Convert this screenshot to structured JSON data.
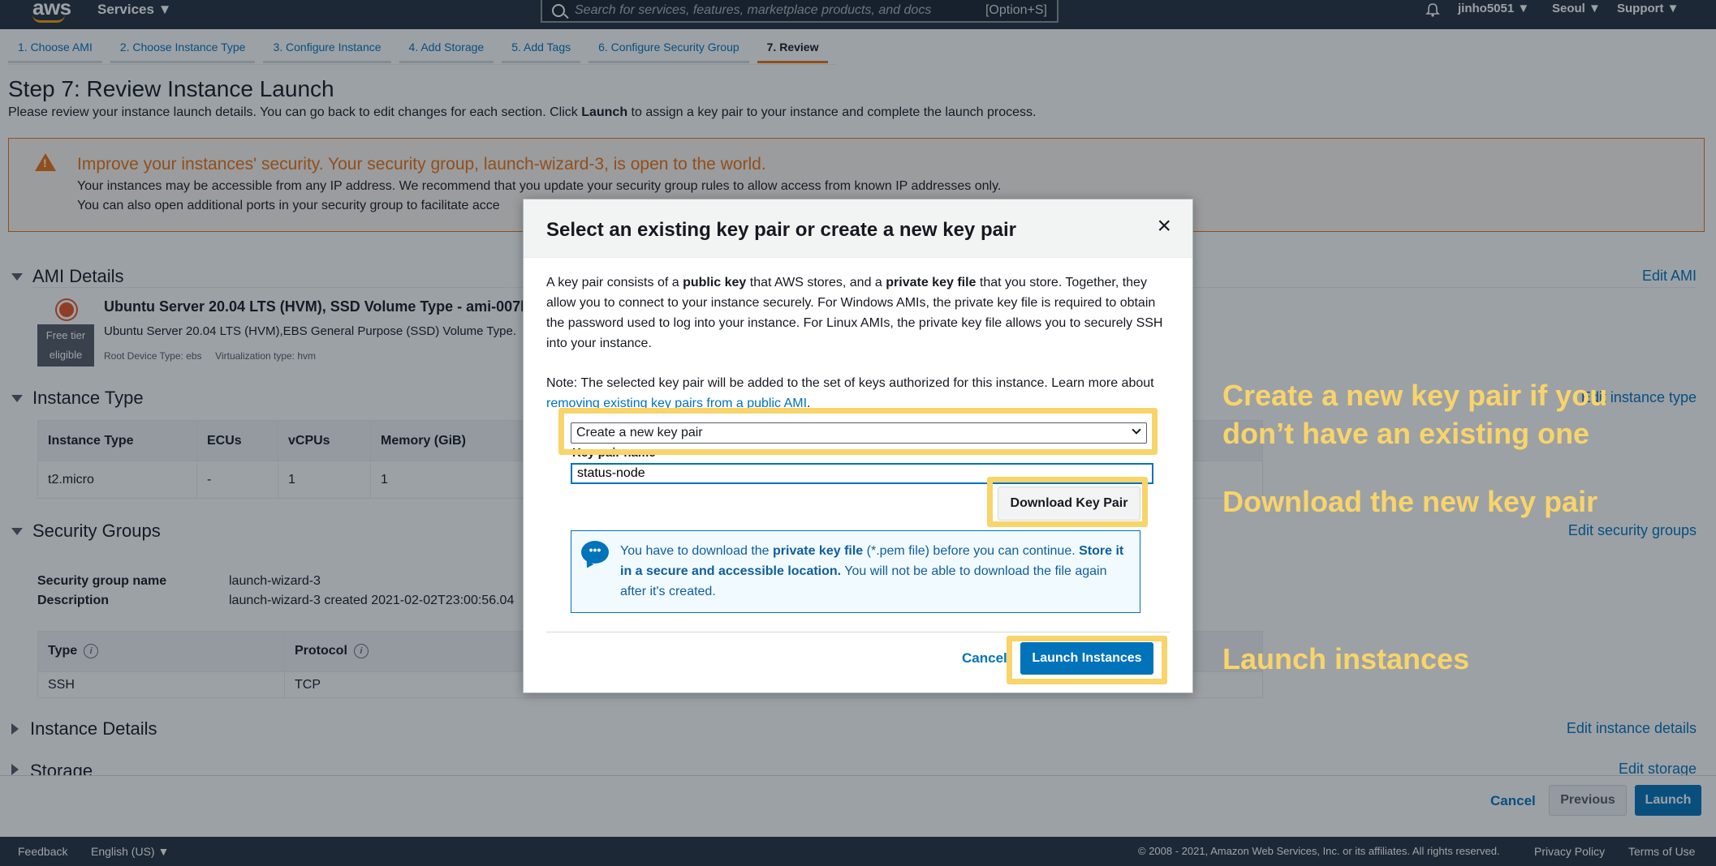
{
  "nav": {
    "logo": "aws",
    "services": "Services ▼",
    "search_placeholder": "Search for services, features, marketplace products, and docs",
    "search_shortcut": "[Option+S]",
    "user": "jinho5051 ▼",
    "region": "Seoul ▼",
    "support": "Support ▼"
  },
  "tabs": [
    "1. Choose AMI",
    "2. Choose Instance Type",
    "3. Configure Instance",
    "4. Add Storage",
    "5. Add Tags",
    "6. Configure Security Group",
    "7. Review"
  ],
  "page": {
    "title": "Step 7: Review Instance Launch",
    "desc_pre": "Please review your instance launch details. You can go back to edit changes for each section. Click ",
    "desc_bold": "Launch",
    "desc_post": " to assign a key pair to your instance and complete the launch process."
  },
  "warning": {
    "title": "Improve your instances' security. Your security group, launch-wizard-3, is open to the world.",
    "line1": "Your instances may be accessible from any IP address. We recommend that you update your security group rules to allow access from known IP addresses only.",
    "line2": "You can also open additional ports in your security group to facilitate acce"
  },
  "sections": {
    "ami": "AMI Details",
    "ami_edit": "Edit AMI",
    "instance_type": "Instance Type",
    "instance_type_edit": "Edit instance type",
    "security_groups": "Security Groups",
    "security_groups_edit": "Edit security groups",
    "instance_details": "Instance Details",
    "instance_details_edit": "Edit instance details",
    "storage": "Storage",
    "storage_edit": "Edit storage"
  },
  "ami": {
    "free_tier_1": "Free tier",
    "free_tier_2": "eligible",
    "name": "Ubuntu Server 20.04 LTS (HVM), SSD Volume Type - ami-007b",
    "sub": "Ubuntu Server 20.04 LTS (HVM),EBS General Purpose (SSD) Volume Type.",
    "meta": "Root Device Type: ebs     Virtualization type: hvm"
  },
  "instance_table": {
    "headers": [
      "Instance Type",
      "ECUs",
      "vCPUs",
      "Memory (GiB)"
    ],
    "row": [
      "t2.micro",
      "-",
      "1",
      "1"
    ]
  },
  "security": {
    "name_label": "Security group name",
    "name_value": "launch-wizard-3",
    "desc_label": "Description",
    "desc_value": "launch-wizard-3 created 2021-02-02T23:00:56.04",
    "headers": [
      "Type",
      "Protocol"
    ],
    "row": [
      "SSH",
      "TCP"
    ],
    "info": "i"
  },
  "bottom": {
    "cancel": "Cancel",
    "previous": "Previous",
    "launch": "Launch"
  },
  "footer": {
    "feedback": "Feedback",
    "language": "English (US) ▼",
    "copyright": "© 2008 - 2021, Amazon Web Services, Inc. or its affiliates. All rights reserved.",
    "privacy": "Privacy Policy",
    "terms": "Terms of Use"
  },
  "modal": {
    "title": "Select an existing key pair or create a new key pair",
    "close": "×",
    "p1_a": "A key pair consists of a ",
    "p1_b": "public key",
    "p1_c": " that AWS stores, and a ",
    "p1_d": "private key file",
    "p1_e": " that you store. Together, they allow you to connect to your instance securely. For Windows AMIs, the private key file is required to obtain the password used to log into your instance. For Linux AMIs, the private key file allows you to securely SSH into your instance.",
    "note_a": "Note: The selected key pair will be added to the set of keys authorized for this instance. Learn more about ",
    "note_link": "removing existing key pairs from a public AMI",
    "note_b": ".",
    "select_value": "Create a new key pair",
    "key_pair_label": "Key pair name",
    "key_pair_value": "status-node",
    "download": "Download Key Pair",
    "notice_a": "You have to download the ",
    "notice_b": "private key file",
    "notice_c": " (*.pem file) before you can continue. ",
    "notice_d": "Store it in a secure and accessible location.",
    "notice_e": " You will not be able to download the file again after it's created.",
    "cancel": "Cancel",
    "launch": "Launch Instances"
  },
  "annotations": {
    "create_1": "Create a new key pair if you",
    "create_2": "don’t have an existing one",
    "download": "Download the new key pair",
    "launch": "Launch instances"
  },
  "colors": {
    "nav_bg": "#232f3e",
    "accent_orange": "#ec7211",
    "link_blue": "#0073bb",
    "highlight_yellow": "#f8d46a"
  }
}
